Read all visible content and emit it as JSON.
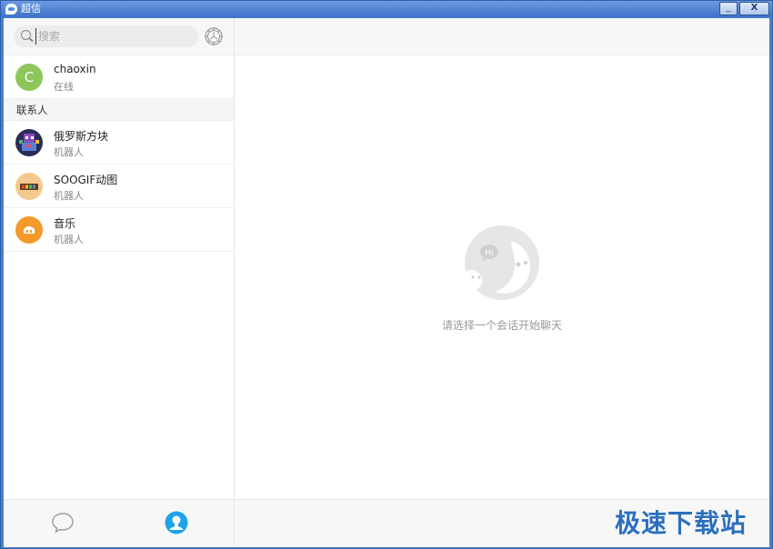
{
  "window": {
    "title": "超信",
    "minimize_label": "_",
    "close_label": "X"
  },
  "search": {
    "placeholder": "搜索"
  },
  "current_user": {
    "avatar_letter": "C",
    "name": "chaoxin",
    "status": "在线"
  },
  "contacts": {
    "section_title": "联系人",
    "items": [
      {
        "name": "俄罗斯方块",
        "subtitle": "机器人",
        "avatar": "tetris-avatar"
      },
      {
        "name": "SOOGIF动图",
        "subtitle": "机器人",
        "avatar": "soogif-avatar"
      },
      {
        "name": "音乐",
        "subtitle": "机器人",
        "avatar": "music-avatar"
      }
    ]
  },
  "main": {
    "empty_hint": "请选择一个会话开始聊天",
    "illustration_bubble": "Hi"
  },
  "watermark": "极速下载站",
  "colors": {
    "accent": "#1fa3e8",
    "online_avatar": "#8dc65a",
    "music_avatar": "#f39a2a",
    "title_bar": "#4a7fd0"
  }
}
